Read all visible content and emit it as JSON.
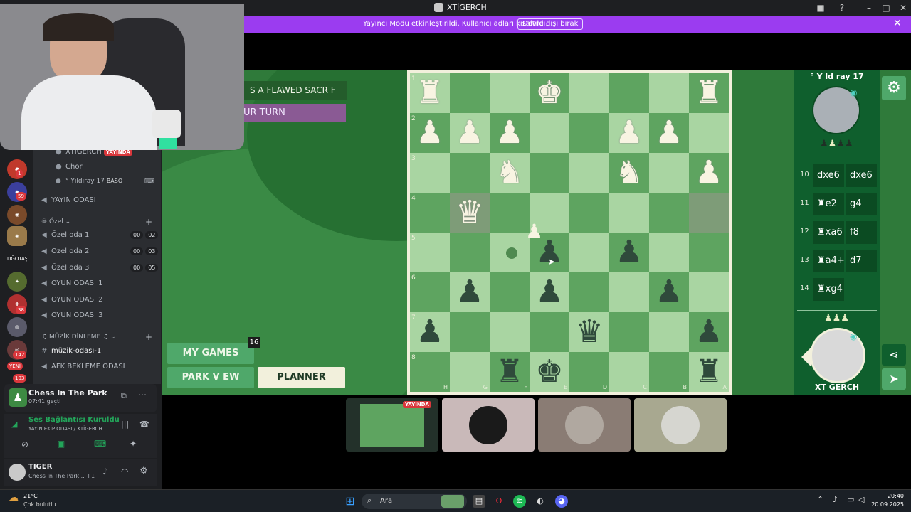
{
  "window": {
    "title": "XTİGERCH"
  },
  "banner": {
    "text": "Yayıncı Modu etkinleştirildi. Kullanıcı adları kısaltıldı.",
    "button": "Devre dışı bırak"
  },
  "servers": {
    "badges": [
      "1",
      "59",
      "38",
      "142",
      "103"
    ],
    "new_label": "YENİ",
    "text_server": "DĞOTAŞ."
  },
  "channels": {
    "voice_users": [
      {
        "name": "XTİGERCH",
        "badge": "YAYINDA"
      },
      {
        "name": "Chor"
      },
      {
        "name": "° Yıldıray 17",
        "badge": "BASO"
      }
    ],
    "yayin_odasi": "YAYIN ODASI",
    "category_ozel": "Özel",
    "ozel_rooms": [
      {
        "name": "Özel oda 1",
        "a": "00",
        "b": "02"
      },
      {
        "name": "Özel oda 2",
        "a": "00",
        "b": "03"
      },
      {
        "name": "Özel oda 3",
        "a": "00",
        "b": "05"
      }
    ],
    "oyun_rooms": [
      "OYUN ODASI 1",
      "OYUN ODASI 2",
      "OYUN ODASI 3"
    ],
    "category_muzik": "MÜZİK DİNLEME",
    "muzik_channel": "müzik-odası-1",
    "afk_channel": "AFK BEKLEME ODASI"
  },
  "activity": {
    "title": "Chess In The Park",
    "time": "07:41 geçti"
  },
  "voice": {
    "status": "Ses Bağlantısı Kuruldu",
    "channel": "YAYIN EKİP ODASI / XTİGERCH"
  },
  "user": {
    "name": "TIGER",
    "status": "Chess In The Park...",
    "extra": "+1"
  },
  "game": {
    "message1": "S A FLAWED SACR F CE",
    "message2": "UR TURN",
    "my_games": "MY GAMES",
    "my_games_count": "16",
    "park_view": "PARK V EW",
    "planner": "PLANNER",
    "top_player": "° Y ld ray 17",
    "bottom_player": "XT GERCH",
    "moves": [
      {
        "num": "10",
        "w": "dxe6",
        "b": "dxe6"
      },
      {
        "num": "11",
        "w": "♜e2",
        "b": "g4"
      },
      {
        "num": "12",
        "w": "♜xa6",
        "b": "f8"
      },
      {
        "num": "13",
        "w": "♜a4+",
        "b": "d7"
      },
      {
        "num": "14",
        "w": "♜xg4",
        "b": ""
      }
    ],
    "ranks": [
      "1",
      "2",
      "3",
      "4",
      "5",
      "6",
      "7",
      "8"
    ],
    "files": [
      "H",
      "G",
      "F",
      "E",
      "D",
      "C",
      "B",
      "A"
    ]
  },
  "thumbs": {
    "live_label": "YAYINDA"
  },
  "taskbar": {
    "weather_temp": "21°C",
    "weather_desc": "Çok bulutlu",
    "search": "Ara",
    "time": "20:40",
    "date": "20.09.2025"
  },
  "colors": {
    "accent": "#9b3cf0",
    "board_light": "#a9d5a2",
    "board_dark": "#5ea460",
    "park_green": "#2f7a3a",
    "live_red": "#da373c"
  }
}
